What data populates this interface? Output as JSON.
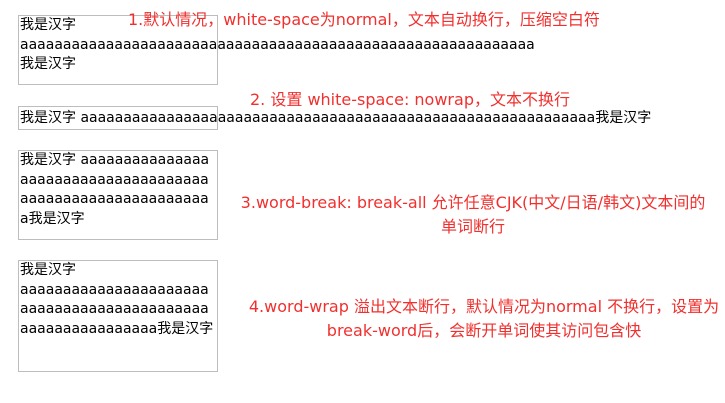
{
  "demos": [
    {
      "text": "我是汉字 aaaaaaaaaaaaaaaaaaaaaaaaaaaaaaaaaaaaaaaaaaaaaaaaaaaaaaaaaaaa 我是汉字",
      "caption": "1.默认情况，white-space为normal，文本自动换行，压缩空白符"
    },
    {
      "text": "我是汉字 aaaaaaaaaaaaaaaaaaaaaaaaaaaaaaaaaaaaaaaaaaaaaaaaaaaaaaaaaaaa我是汉字",
      "caption": "2. 设置 white-space: nowrap，文本不换行"
    },
    {
      "text": "我是汉字 aaaaaaaaaaaaaaaaaaaaaaaaaaaaaaaaaaaaaaaaaaaaaaaaaaaaaaaaaaaa我是汉字",
      "caption": "3.word-break: break-all 允许任意CJK(中文/日语/韩文)文本间的单词断行"
    },
    {
      "text": "我是汉字 aaaaaaaaaaaaaaaaaaaaaaaaaaaaaaaaaaaaaaaaaaaaaaaaaaaaaaaaaaaa我是汉字",
      "caption": "4.word-wrap 溢出文本断行，默认情况为normal 不换行，设置为break-word后，会断开单词使其访问包含快"
    }
  ],
  "colors": {
    "caption": "#f0302e",
    "box_border": "#bdbdbd"
  }
}
